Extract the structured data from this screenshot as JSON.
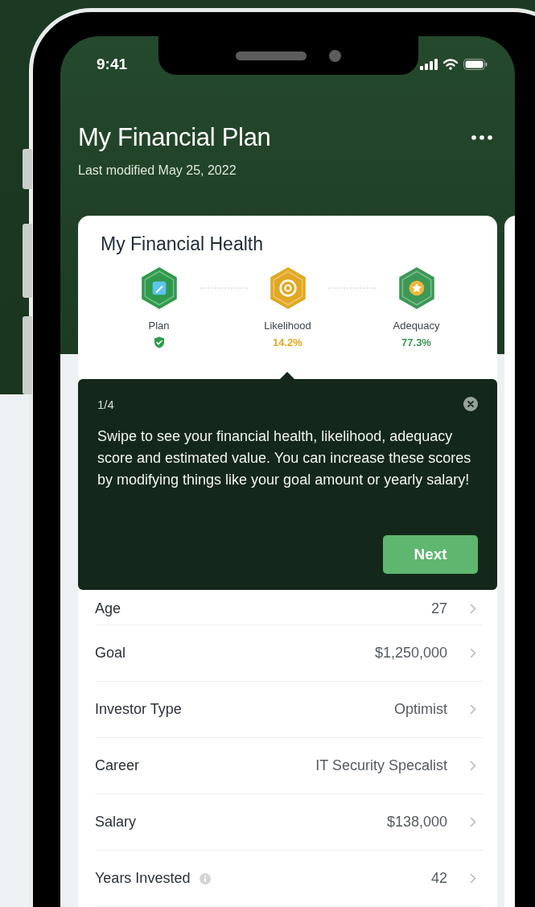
{
  "status_bar": {
    "time": "9:41"
  },
  "header": {
    "title": "My Financial Plan",
    "subtitle": "Last modified May 25, 2022"
  },
  "card": {
    "title": "My Financial Health",
    "metrics": [
      {
        "label": "Plan",
        "kind": "status",
        "color": "#2f9a4c"
      },
      {
        "label": "Likelihood",
        "kind": "score",
        "value": "14.2%",
        "color": "#e2a823"
      },
      {
        "label": "Adequacy",
        "kind": "score",
        "value": "77.3%",
        "color": "#3c9856"
      }
    ],
    "rows": [
      {
        "label": "Age",
        "value": "27",
        "info": false
      },
      {
        "label": "Goal",
        "value": "$1,250,000",
        "info": false
      },
      {
        "label": "Investor Type",
        "value": "Optimist",
        "info": false
      },
      {
        "label": "Career",
        "value": "IT Security Specalist",
        "info": false
      },
      {
        "label": "Salary",
        "value": "$138,000",
        "info": false
      },
      {
        "label": "Years Invested",
        "value": "42",
        "info": true
      }
    ]
  },
  "tooltip": {
    "step": "1/4",
    "text": "Swipe to see your financial health, likelihood, adequacy score and estimated value. You can increase these scores by modifying things like your goal amount or yearly salary!",
    "button": "Next"
  }
}
